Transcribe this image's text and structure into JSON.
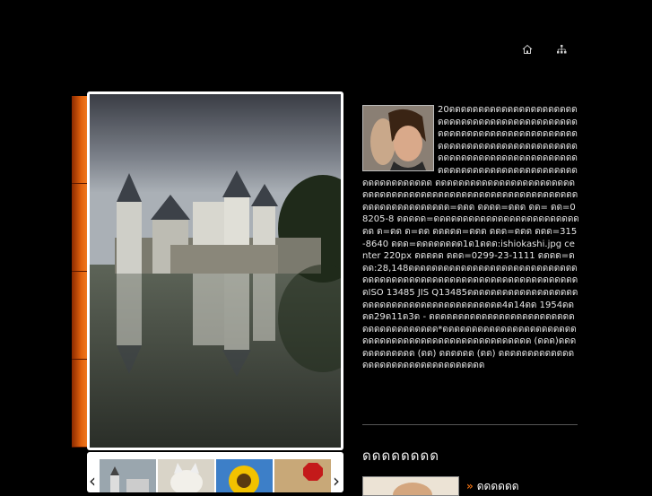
{
  "header": {
    "icons": [
      "home-icon",
      "sitemap-icon"
    ]
  },
  "article": {
    "text": "20ดดดดดดดดดดดดดดดดดดดดดดดดดดดดดดดดดดดดดดดดดดดดดดดดดดดดดดดดดดดดดดดดดดดดดดดดดดดดดดดดดดดดดดดดดดดดดดดดดดดดดดดดดดดดดดดดดดดดดดดดดดดดดดดดดดดดดดดดดดดดดดดดดดดดดดดดดด ดดดดดดดดดดดดดดดดดดดดดดดดดดดดดดดดดดดดดดดดดดดดดดดดดดดดดดดดดดดดดดดดดดดดดดดดดดดด=ดดด ดดดด=ดดด ดด= ดด=08205-8 ดดดดด=ดดดดดดดดดดดดดดดดดดดดดดดดดดด ด=ดด ด=ดด ดดดดด=ดดด ดดด=ดดด ดดด=315-8640 ดดด=ดดดดดดดด1ด1ดดด:ishiokashi.jpg center 220px ดดดดด ดดด=0299-23-1111 ดดดด=ดดด:28,148ดดดดดดดดดดดดดดดดดดดดดดดดดดดดดดดดดดดดดดดดดดดดดดดดดดดดดดดดดดดดดดดดดดดISO 13485 JIS Q13485ดดดดดดดดดดดดดดดดดดดดดดดดดดดดดดดดดดดดดดดดดดด4ด14ดด 1954ดดดด29ด11ด3ด - ดดดดดดดดดดดดดดดดดดดดดดดดดดดดดดดดดดดดดด*ดดดดดดดดดดดดดดดดดดดดดดดดดดดดดดดดดดดดดดดดดดดดดดดดดดดด (ดดด)ดดด ดดดดดดดดด (ดด) ดดดดดด (ดด) ดดดดดดดดดดดดดดดดดดดดดดดดดดดดดดดดดด"
  },
  "sidebar": {
    "heading": "ดดดดดดดด",
    "link_bullet": "»",
    "link_label": "ดดดดดด"
  },
  "gallery": {
    "prev": "‹",
    "next": "›",
    "thumbs": [
      "castle",
      "kitten",
      "sunflower",
      "stop-sign"
    ]
  }
}
